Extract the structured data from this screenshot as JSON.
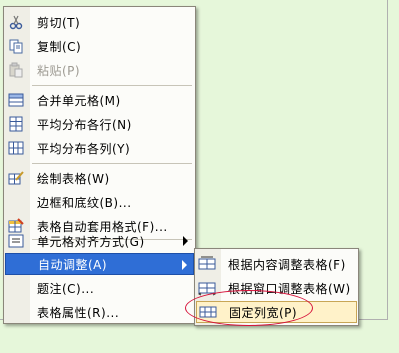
{
  "context_menu": {
    "items": [
      {
        "label": "剪切(T)",
        "icon": "scissors-icon",
        "enabled": true
      },
      {
        "label": "复制(C)",
        "icon": "copy-icon",
        "enabled": true
      },
      {
        "label": "粘贴(P)",
        "icon": "paste-icon",
        "enabled": false
      },
      {
        "label": "合并单元格(M)",
        "icon": "merge-cells-icon",
        "enabled": true
      },
      {
        "label": "平均分布各行(N)",
        "icon": "distribute-rows-icon",
        "enabled": true
      },
      {
        "label": "平均分布各列(Y)",
        "icon": "distribute-columns-icon",
        "enabled": true
      },
      {
        "label": "绘制表格(W)",
        "icon": "draw-table-icon",
        "enabled": true
      },
      {
        "label": "边框和底纹(B)...",
        "icon": "",
        "enabled": true
      },
      {
        "label": "表格自动套用格式(F)...",
        "icon": "table-autoformat-icon",
        "enabled": true
      },
      {
        "label": "单元格对齐方式(G)",
        "icon": "cell-alignment-icon",
        "enabled": true,
        "submenu": true
      },
      {
        "label": "自动调整(A)",
        "icon": "",
        "enabled": true,
        "submenu": true,
        "highlighted": true
      },
      {
        "label": "题注(C)...",
        "icon": "",
        "enabled": true
      },
      {
        "label": "表格属性(R)...",
        "icon": "",
        "enabled": true
      }
    ]
  },
  "submenu_autofit": {
    "items": [
      {
        "label": "根据内容调整表格(F)",
        "icon": "autofit-contents-icon"
      },
      {
        "label": "根据窗口调整表格(W)",
        "icon": "autofit-window-icon"
      },
      {
        "label": "固定列宽(P)",
        "icon": "fixed-column-width-icon",
        "selected": true
      }
    ]
  },
  "colors": {
    "highlight": "#2f6ed6",
    "selected": "#fff2c9",
    "annotation": "#d6123a",
    "background": "#e6f7da"
  }
}
